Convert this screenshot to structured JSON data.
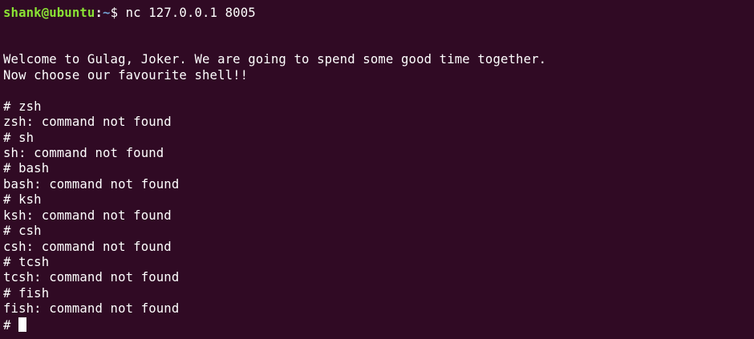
{
  "prompt": {
    "user_host": "shank@ubuntu",
    "separator": ":",
    "path": "~",
    "symbol": "$ ",
    "command": "nc 127.0.0.1 8005"
  },
  "output": {
    "welcome_line_1": "Welcome to Gulag, Joker. We are going to spend some good time together.",
    "welcome_line_2": "Now choose our favourite shell!!",
    "session_lines": [
      "# zsh",
      "zsh: command not found",
      "# sh",
      "sh: command not found",
      "# bash",
      "bash: command not found",
      "# ksh",
      "ksh: command not found",
      "# csh",
      "csh: command not found",
      "# tcsh",
      "tcsh: command not found",
      "# fish",
      "fish: command not found"
    ],
    "final_prompt": "# "
  },
  "colors": {
    "background": "#300a24",
    "text": "#ffffff",
    "user_host": "#8ae234",
    "path": "#729fcf"
  }
}
